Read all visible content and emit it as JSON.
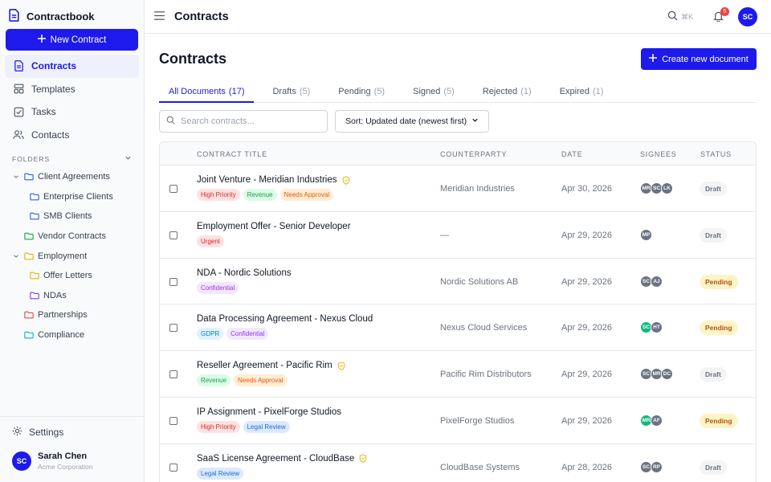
{
  "app": {
    "name": "Contractbook"
  },
  "sidebar": {
    "new_button": "New Contract",
    "nav": [
      {
        "label": "Contracts",
        "icon": "document-icon",
        "active": true
      },
      {
        "label": "Templates",
        "icon": "template-icon",
        "active": false
      },
      {
        "label": "Tasks",
        "icon": "checkbox-icon",
        "active": false
      },
      {
        "label": "Contacts",
        "icon": "users-icon",
        "active": false
      }
    ],
    "folders_label": "FOLDERS",
    "folders": [
      {
        "label": "Client Agreements",
        "color": "#2563eb",
        "level": 0,
        "expanded": true
      },
      {
        "label": "Enterprise Clients",
        "color": "#2563eb",
        "level": 1
      },
      {
        "label": "SMB Clients",
        "color": "#2563eb",
        "level": 1
      },
      {
        "label": "Vendor Contracts",
        "color": "#16a34a",
        "level": 0
      },
      {
        "label": "Employment",
        "color": "#eab308",
        "level": 0,
        "expanded": true
      },
      {
        "label": "Offer Letters",
        "color": "#eab308",
        "level": 1
      },
      {
        "label": "NDAs",
        "color": "#7c3aed",
        "level": 1
      },
      {
        "label": "Partnerships",
        "color": "#ef4444",
        "level": 0
      },
      {
        "label": "Compliance",
        "color": "#06b6d4",
        "level": 0
      }
    ],
    "settings": "Settings",
    "user": {
      "initials": "SC",
      "name": "Sarah Chen",
      "org": "Acme Corporation"
    }
  },
  "topbar": {
    "title": "Contracts",
    "shortcut": "⌘K",
    "notifications": "5",
    "avatar": "SC"
  },
  "page": {
    "title": "Contracts",
    "create_button": "Create new document",
    "tabs": [
      {
        "label": "All Documents",
        "count": "(17)",
        "active": true
      },
      {
        "label": "Drafts",
        "count": "(5)"
      },
      {
        "label": "Pending",
        "count": "(5)"
      },
      {
        "label": "Signed",
        "count": "(5)"
      },
      {
        "label": "Rejected",
        "count": "(1)"
      },
      {
        "label": "Expired",
        "count": "(1)"
      }
    ],
    "search_placeholder": "Search contracts...",
    "sort_label": "Sort: Updated date (newest first)"
  },
  "table": {
    "headers": {
      "title": "CONTRACT TITLE",
      "counterparty": "COUNTERPARTY",
      "date": "DATE",
      "signees": "SIGNEES",
      "status": "STATUS"
    },
    "rows": [
      {
        "title": "Joint Venture - Meridian Industries",
        "shield": true,
        "tags": [
          "High Priority",
          "Revenue",
          "Needs Approval"
        ],
        "counterparty": "Meridian Industries",
        "date": "Apr 30, 2026",
        "signees": [
          {
            "i": "MR",
            "c": "#6b7280"
          },
          {
            "i": "SC",
            "c": "#6b7280"
          },
          {
            "i": "LK",
            "c": "#6b7280"
          }
        ],
        "status": "Draft"
      },
      {
        "title": "Employment Offer - Senior Developer",
        "shield": false,
        "tags": [
          "Urgent"
        ],
        "counterparty": "—",
        "date": "Apr 29, 2026",
        "signees": [
          {
            "i": "MP",
            "c": "#6b7280"
          }
        ],
        "status": "Draft"
      },
      {
        "title": "NDA - Nordic Solutions",
        "shield": false,
        "tags": [
          "Confidential"
        ],
        "counterparty": "Nordic Solutions AB",
        "date": "Apr 29, 2026",
        "signees": [
          {
            "i": "SC",
            "c": "#6b7280"
          },
          {
            "i": "AJ",
            "c": "#6b7280"
          }
        ],
        "status": "Pending"
      },
      {
        "title": "Data Processing Agreement - Nexus Cloud",
        "shield": false,
        "tags": [
          "GDPR",
          "Confidential"
        ],
        "counterparty": "Nexus Cloud Services",
        "date": "Apr 29, 2026",
        "signees": [
          {
            "i": "SC",
            "c": "#10b981"
          },
          {
            "i": "HT",
            "c": "#6b7280"
          }
        ],
        "status": "Pending"
      },
      {
        "title": "Reseller Agreement - Pacific Rim",
        "shield": true,
        "tags": [
          "Revenue",
          "Needs Approval"
        ],
        "counterparty": "Pacific Rim Distributors",
        "date": "Apr 29, 2026",
        "signees": [
          {
            "i": "SC",
            "c": "#6b7280"
          },
          {
            "i": "MR",
            "c": "#6b7280"
          },
          {
            "i": "DC",
            "c": "#6b7280"
          }
        ],
        "status": "Draft"
      },
      {
        "title": "IP Assignment - PixelForge Studios",
        "shield": false,
        "tags": [
          "High Priority",
          "Legal Review"
        ],
        "counterparty": "PixelForge Studios",
        "date": "Apr 29, 2026",
        "signees": [
          {
            "i": "MR",
            "c": "#10b981"
          },
          {
            "i": "AF",
            "c": "#6b7280"
          }
        ],
        "status": "Pending"
      },
      {
        "title": "SaaS License Agreement - CloudBase",
        "shield": true,
        "tags": [
          "Legal Review"
        ],
        "counterparty": "CloudBase Systems",
        "date": "Apr 28, 2026",
        "signees": [
          {
            "i": "SC",
            "c": "#6b7280"
          },
          {
            "i": "RP",
            "c": "#6b7280"
          }
        ],
        "status": "Draft"
      }
    ]
  },
  "tag_styles": {
    "High Priority": {
      "bg": "#fee2e2",
      "fg": "#dc2626"
    },
    "Urgent": {
      "bg": "#fee2e2",
      "fg": "#dc2626"
    },
    "Revenue": {
      "bg": "#dcfce7",
      "fg": "#16a34a"
    },
    "Needs Approval": {
      "bg": "#ffedd5",
      "fg": "#ea580c"
    },
    "Confidential": {
      "bg": "#f3e8ff",
      "fg": "#9333ea"
    },
    "GDPR": {
      "bg": "#e0f2fe",
      "fg": "#0284c7"
    },
    "Legal Review": {
      "bg": "#dbeafe",
      "fg": "#2563eb"
    }
  },
  "status_styles": {
    "Draft": {
      "bg": "#f3f4f6",
      "fg": "#6b7280"
    },
    "Pending": {
      "bg": "#fef3c7",
      "fg": "#b45309"
    }
  },
  "accent": "#1d1aeb"
}
